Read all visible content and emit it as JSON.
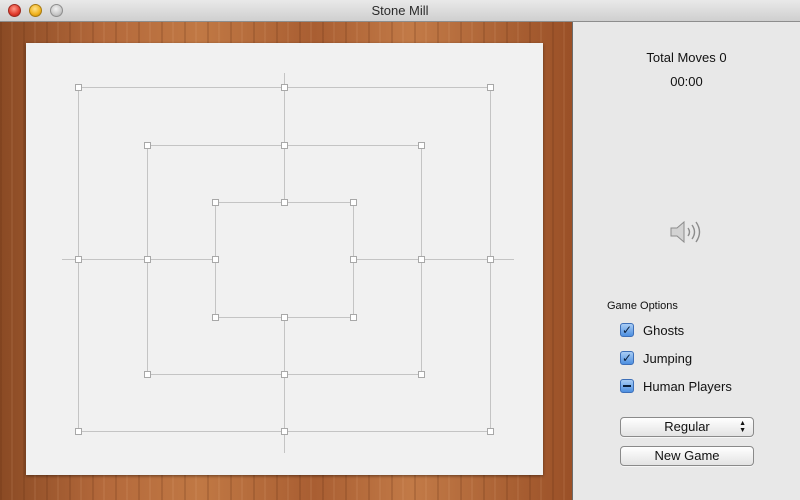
{
  "window": {
    "title": "Stone Mill"
  },
  "status": {
    "moves_label": "Total Moves 0",
    "timer": "00:00"
  },
  "sound": {
    "icon": "speaker-icon"
  },
  "options": {
    "heading": "Game Options",
    "items": [
      {
        "label": "Ghosts",
        "state": "checked"
      },
      {
        "label": "Jumping",
        "state": "checked"
      },
      {
        "label": "Human Players",
        "state": "mixed"
      }
    ]
  },
  "controls": {
    "mode_selected": "Regular",
    "new_game_label": "New Game"
  },
  "colors": {
    "board_background": "#f1f1f1",
    "line": "#c4c4c4",
    "checkbox_accent": "#4d8fe0"
  }
}
